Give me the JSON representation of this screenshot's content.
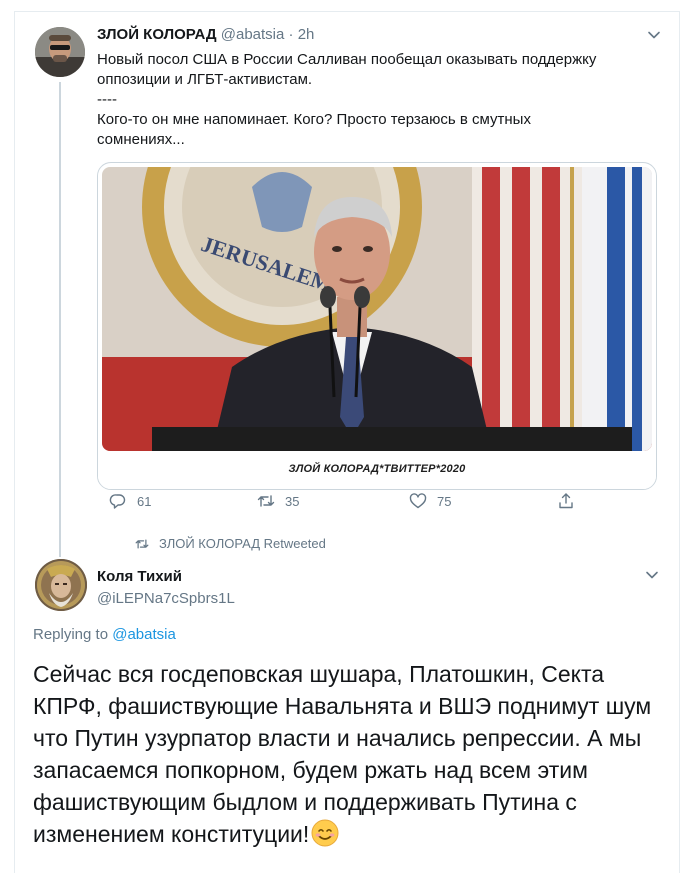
{
  "tweet1": {
    "author_name": "ЗЛОЙ КОЛОРАД",
    "author_handle": "@abatsia",
    "separator": " · ",
    "time": "2h",
    "line1": "Новый посол США в России Салливан пообещал оказывать поддержку",
    "line2": "оппозиции и ЛГБТ-активистам.",
    "line3": "----",
    "line4": "Кого-то он мне напоминает. Кого? Просто терзаюсь в смутных",
    "line5": "сомнениях...",
    "image_seal_text": "JERUSALEM, IS",
    "image_caption": "ЗЛОЙ КОЛОРАД*ТВИТТЕР*2020",
    "replies": "61",
    "retweets": "35",
    "likes": "75"
  },
  "retweet_banner": "ЗЛОЙ КОЛОРАД Retweeted",
  "tweet2": {
    "author_name": "Коля Тихий",
    "author_handle": "@iLEPNa7cSpbrs1L",
    "replying_prefix": "Replying to ",
    "replying_to": "@abatsia",
    "text": "Сейчас вся госдеповская шушара, Платошкин, Секта КПРФ,  фашиствующие Навальнята и ВШЭ поднимут шум что Путин узурпатор власти и начались репрессии. А мы запасаемся попкорном, будем ржать над всем этим фашиствующим быдлом и поддерживать Путина с изменением конституции!",
    "emoji": "smiling-face-emoji"
  },
  "icons": {
    "reply": "reply-icon",
    "retweet": "retweet-icon",
    "like": "heart-icon",
    "share": "share-icon",
    "caret": "chevron-down-icon"
  },
  "colors": {
    "link": "#1b95e0",
    "secondary_text": "#657786",
    "primary_text": "#14171a",
    "border": "#e6ecf0"
  }
}
